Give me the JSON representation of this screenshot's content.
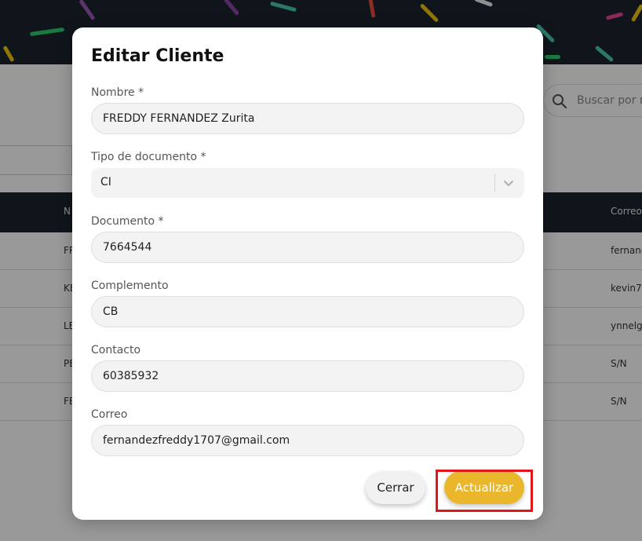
{
  "background": {
    "search_placeholder": "Buscar por n",
    "table": {
      "headers": [
        "N",
        "Correo"
      ],
      "rows": [
        {
          "name": "FR",
          "email": "fernand"
        },
        {
          "name": "KE",
          "email": "kevin7."
        },
        {
          "name": "LE",
          "email": "ynnelg"
        },
        {
          "name": "PE",
          "email": "S/N"
        },
        {
          "name": "FE",
          "email": "S/N"
        }
      ]
    }
  },
  "modal": {
    "title": "Editar Cliente",
    "fields": {
      "nombre": {
        "label": "Nombre *",
        "value": "FREDDY FERNANDEZ Zurita"
      },
      "tipo_documento": {
        "label": "Tipo de documento *",
        "value": "CI"
      },
      "documento": {
        "label": "Documento *",
        "value": "7664544"
      },
      "complemento": {
        "label": "Complemento",
        "value": "CB"
      },
      "contacto": {
        "label": "Contacto",
        "value": "60385932"
      },
      "correo": {
        "label": "Correo",
        "value": "fernandezfreddy1707@gmail.com"
      }
    },
    "buttons": {
      "close_label": "Cerrar",
      "update_label": "Actualizar"
    }
  },
  "colors": {
    "accent": "#eab72c",
    "header_dark": "#1c2330",
    "highlight": "#e0161b"
  }
}
